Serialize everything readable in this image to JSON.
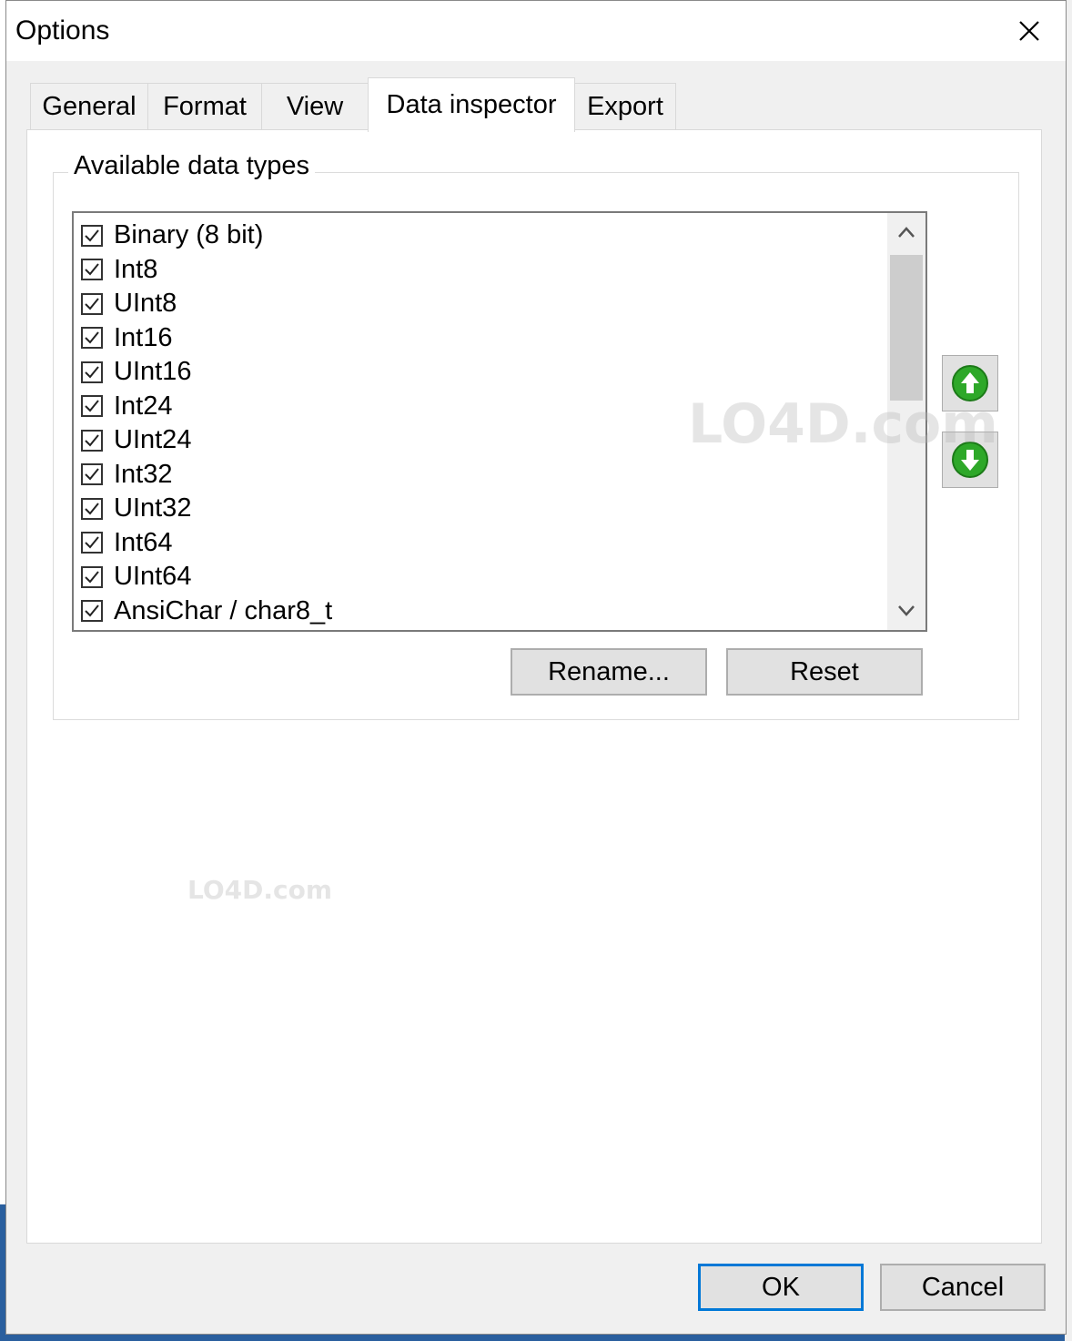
{
  "window": {
    "title": "Options",
    "close_glyph": "✕"
  },
  "tabs": [
    {
      "label": "General"
    },
    {
      "label": "Format"
    },
    {
      "label": "View"
    },
    {
      "label": "Data inspector",
      "active": true
    },
    {
      "label": "Export"
    }
  ],
  "group": {
    "label": "Available data types"
  },
  "data_types": [
    {
      "label": "Binary (8 bit)",
      "checked": true
    },
    {
      "label": "Int8",
      "checked": true
    },
    {
      "label": "UInt8",
      "checked": true
    },
    {
      "label": "Int16",
      "checked": true
    },
    {
      "label": "UInt16",
      "checked": true
    },
    {
      "label": "Int24",
      "checked": true
    },
    {
      "label": "UInt24",
      "checked": true
    },
    {
      "label": "Int32",
      "checked": true
    },
    {
      "label": "UInt32",
      "checked": true
    },
    {
      "label": "Int64",
      "checked": true
    },
    {
      "label": "UInt64",
      "checked": true
    },
    {
      "label": "AnsiChar / char8_t",
      "checked": true
    }
  ],
  "buttons": {
    "rename": "Rename...",
    "reset": "Reset",
    "ok": "OK",
    "cancel": "Cancel"
  },
  "icons": {
    "move_up": "arrow-up-icon",
    "move_down": "arrow-down-icon"
  },
  "colors": {
    "accent": "#0078d7",
    "arrow_green": "#2ea829"
  },
  "watermark": {
    "text": "LO4D.com"
  }
}
